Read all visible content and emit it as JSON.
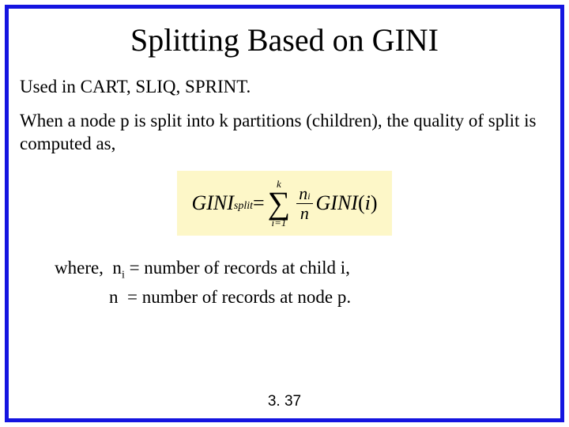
{
  "title": "Splitting Based on GINI",
  "bullet1": "Used in CART, SLIQ, SPRINT.",
  "bullet2": "When a node p is split into k partitions (children), the quality of split is computed as,",
  "formula": {
    "lhs_main": "GINI",
    "lhs_sub": "split",
    "eq": " = ",
    "sum_top": "k",
    "sum_sym": "∑",
    "sum_bot": "i=1",
    "frac_num_var": "n",
    "frac_num_sub": "i",
    "frac_den": "n",
    "rhs_func": "GINI",
    "rhs_arg_open": "(",
    "rhs_arg": "i",
    "rhs_arg_close": ")"
  },
  "where": {
    "line1_pre": "where,  n",
    "line1_sub": "i",
    "line1_post": " = number of records at child i,",
    "line2_pre": "            n  = number of records at node p."
  },
  "page_number": "3. 37"
}
